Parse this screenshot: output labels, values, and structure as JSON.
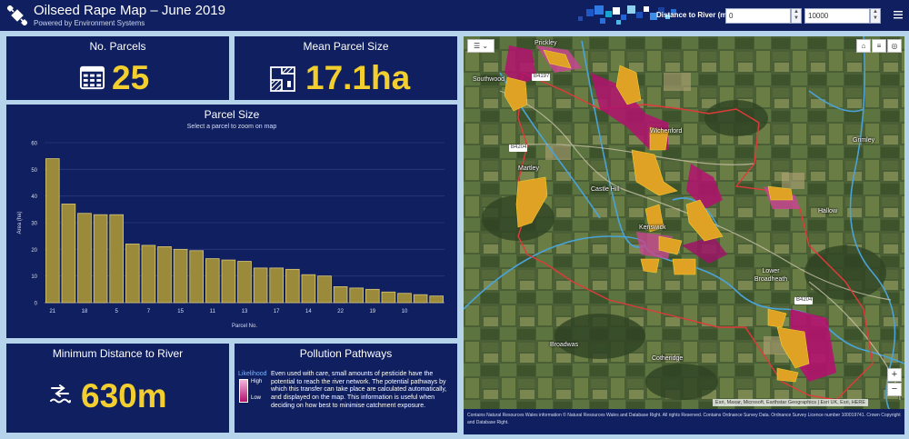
{
  "header": {
    "title": "Oilseed Rape Map – June 2019",
    "subtitle": "Powered by Environment Systems",
    "distance_label": "Distance to River (m)",
    "distance_min": "0",
    "distance_max": "10000"
  },
  "kpis": {
    "parcels_label": "No. Parcels",
    "parcels_value": "25",
    "mean_size_label": "Mean Parcel Size",
    "mean_size_value": "17.1ha",
    "min_distance_label": "Minimum Distance to River",
    "min_distance_value": "630m"
  },
  "chart_panel": {
    "title": "Parcel Size",
    "subtitle": "Select a parcel to zoom on map"
  },
  "chart_data": {
    "type": "bar",
    "title": "Parcel Size",
    "xlabel": "Parcel No.",
    "ylabel": "Area (ha)",
    "ylim": [
      0,
      60
    ],
    "yticks": [
      0,
      10,
      20,
      30,
      40,
      50,
      60
    ],
    "values": [
      54,
      37,
      33.5,
      33,
      33,
      22,
      21.5,
      21,
      20,
      19.5,
      16.5,
      16,
      15.5,
      13,
      13,
      12.5,
      10.5,
      10,
      6,
      5.5,
      5,
      4,
      3.5,
      3,
      2.5
    ],
    "xtick_labels": [
      "21",
      "18",
      "5",
      "7",
      "15",
      "11",
      "13",
      "17",
      "14",
      "22",
      "19",
      "10"
    ],
    "xtick_bar_index": [
      0,
      2,
      4,
      6,
      8,
      10,
      12,
      14,
      16,
      18,
      20,
      22
    ],
    "bar_color": "#9a8a3a",
    "grid": true
  },
  "pollution": {
    "title": "Pollution Pathways",
    "legend_title": "Likelihood",
    "legend_high": "High",
    "legend_low": "Low",
    "text": "Even used with care, small amounts of pesticide have the potential to reach the river network. The potential pathways by which this transfer can take place are calculated automatically, and displayed on the map. This information is useful when deciding on how best to minimise catchment exposure."
  },
  "map": {
    "place_labels": [
      {
        "name": "Prickley"
      },
      {
        "name": "Southwood"
      },
      {
        "name": "Wichenford"
      },
      {
        "name": "Martley"
      },
      {
        "name": "Castle Hill"
      },
      {
        "name": "Kenswick"
      },
      {
        "name": "Grimley"
      },
      {
        "name": "Hallow"
      },
      {
        "name": "Lower Broadheath"
      },
      {
        "name": "Broadwas"
      },
      {
        "name": "Cotheridge"
      }
    ],
    "road_labels": [
      "B4197",
      "B4204",
      "B4204"
    ],
    "attribution": "Esri, Maxar, Microsoft, Earthstar Geographics | Esri UK, Esri, HERE",
    "footer": "Contains Natural Resources Wales information © Natural Resources Wales and Database Right. All rights Reserved. Contains Ordnance Survey Data. Ordnance Survey Licence number 100019741. Crown Copyright and Database Right.",
    "zoom_in": "+",
    "zoom_out": "−"
  },
  "colors": {
    "header_bg": "#0f1f5f",
    "panel_bg": "#0f1f5f",
    "accent": "#f2cf2f",
    "bar": "#9a8a3a",
    "boundary": "#e03a3a",
    "river": "#4aa3d8",
    "pathway_high": "#b3126e",
    "parcel": "#e0a224"
  }
}
